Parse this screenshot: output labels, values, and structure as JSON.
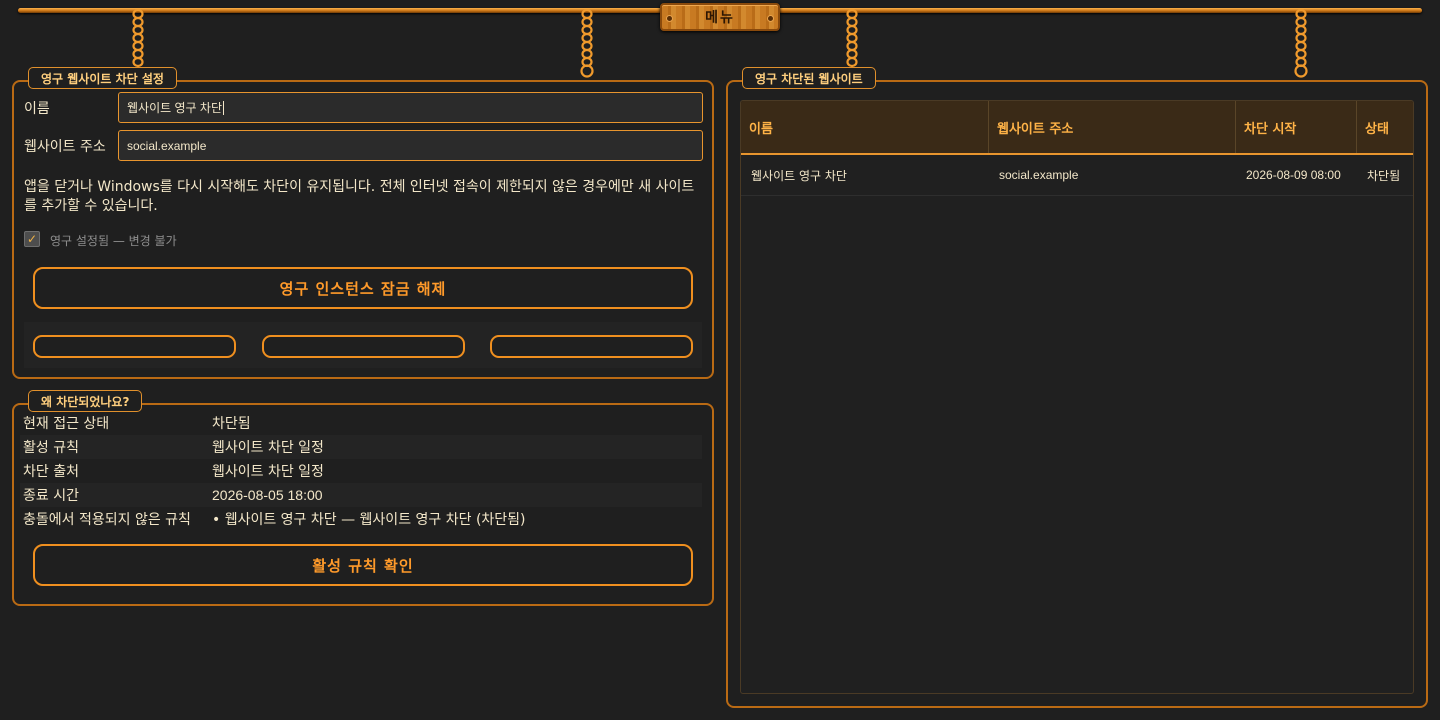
{
  "menu": {
    "label": "메뉴"
  },
  "settings": {
    "legend": "영구 웹사이트 차단 설정",
    "name_label": "이름",
    "name_value": "웹사이트 영구 차단",
    "url_label": "웹사이트 주소",
    "url_value": "social.example",
    "note": "앱을 닫거나 Windows를 다시 시작해도 차단이 유지됩니다. 전체 인터넷 접속이 제한되지 않은 경우에만 새 사이트를 추가할 수 있습니다.",
    "permanent_checkbox_label": "영구 설정됨 — 변경 불가",
    "unlock_button": "영구 인스턴스 잠금 해제"
  },
  "why": {
    "legend": "왜 차단되었나요?",
    "rows": [
      {
        "key": "현재 접근 상태",
        "value": "차단됨"
      },
      {
        "key": "활성 규칙",
        "value": "웹사이트 차단 일정"
      },
      {
        "key": "차단 출처",
        "value": "웹사이트 차단 일정"
      },
      {
        "key": "종료 시간",
        "value": "2026-08-05 18:00"
      },
      {
        "key": "충돌에서 적용되지 않은 규칙",
        "value": "• 웹사이트 영구 차단 — 웹사이트 영구 차단 (차단됨)"
      }
    ],
    "check_button": "활성 규칙 확인"
  },
  "blocked": {
    "legend": "영구 차단된 웹사이트",
    "columns": [
      "이름",
      "웹사이트 주소",
      "차단 시작",
      "상태"
    ],
    "rows": [
      [
        "웹사이트 영구 차단",
        "social.example",
        "2026-08-09 08:00",
        "차단됨"
      ]
    ]
  },
  "icons": {
    "check": "checkmark-icon",
    "chain": "chain-icon"
  },
  "colors": {
    "accent": "#ef8f1f",
    "background": "#1f1f1f",
    "text": "#f3e7c9",
    "legend_text": "#ffcf7e"
  }
}
